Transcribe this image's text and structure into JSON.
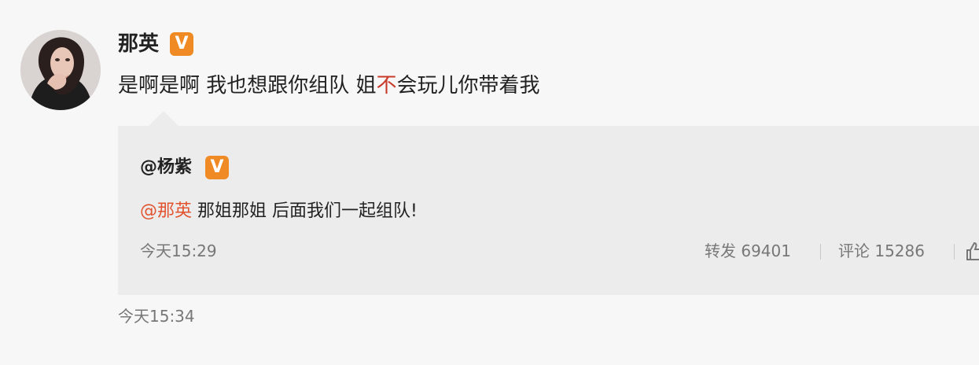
{
  "post": {
    "author": "那英",
    "text_before": "是啊是啊 我也想跟你组队 姐",
    "text_highlight": "不",
    "text_after": "会玩儿你带着我",
    "time": "今天15:34"
  },
  "quoted": {
    "author": "@杨紫",
    "mention": "@那英",
    "text": " 那姐那姐 后面我们一起组队!",
    "time": "今天15:29",
    "repost_label": "转发",
    "repost_count": "69401",
    "comment_label": "评论",
    "comment_count": "15286"
  },
  "badge": {
    "text": "V",
    "color": "#f08a24"
  },
  "colors": {
    "mention": "#e2532f",
    "highlight": "#c83a2a",
    "quote_background": "#ececec"
  },
  "icons": {
    "like": "thumbs-up-icon"
  }
}
